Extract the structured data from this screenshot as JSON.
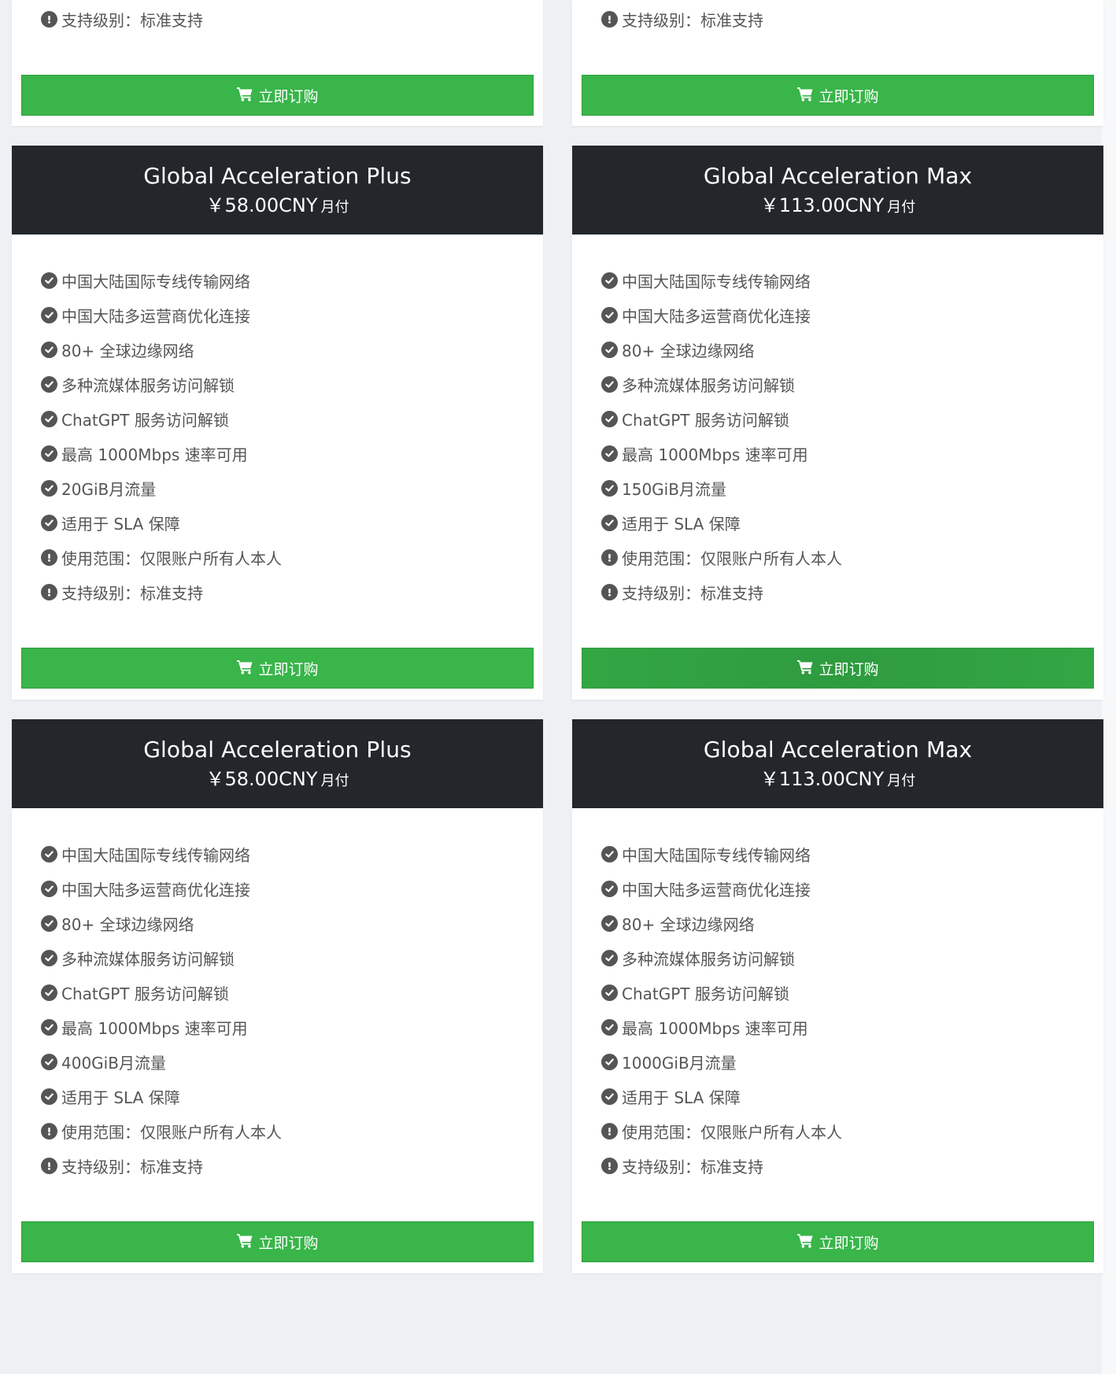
{
  "colors": {
    "header_bg": "#23272b",
    "button_green": "#39b54a",
    "page_bg": "#eef1f4",
    "text_gray": "#555555"
  },
  "icons": {
    "included": "check-circle-icon",
    "notice": "exclamation-circle-icon",
    "button": "shopping-cart-icon"
  },
  "top_partial_cards": [
    {
      "feature": {
        "icon": "exclamation",
        "text": "支持级别：标准支持"
      },
      "button_label": "立即订购"
    },
    {
      "feature": {
        "icon": "exclamation",
        "text": "支持级别：标准支持"
      },
      "button_label": "立即订购"
    }
  ],
  "plans": [
    {
      "name": "Global Acceleration Plus",
      "price": "￥58.00CNY",
      "cycle": "月付",
      "button_label": "立即订购",
      "features": [
        {
          "icon": "check",
          "text": "中国大陆国际专线传输网络"
        },
        {
          "icon": "check",
          "text": "中国大陆多运营商优化连接"
        },
        {
          "icon": "check",
          "text": "80+ 全球边缘网络"
        },
        {
          "icon": "check",
          "text": "多种流媒体服务访问解锁"
        },
        {
          "icon": "check",
          "text": "ChatGPT 服务访问解锁"
        },
        {
          "icon": "check",
          "text": "最高 1000Mbps 速率可用"
        },
        {
          "icon": "check",
          "text": "20GiB月流量"
        },
        {
          "icon": "check",
          "text": "适用于 SLA 保障"
        },
        {
          "icon": "exclamation",
          "text": "使用范围：仅限账户所有人本人"
        },
        {
          "icon": "exclamation",
          "text": "支持级别：标准支持"
        }
      ]
    },
    {
      "name": "Global Acceleration Max",
      "price": "￥113.00CNY",
      "cycle": "月付",
      "button_label": "立即订购",
      "features": [
        {
          "icon": "check",
          "text": "中国大陆国际专线传输网络"
        },
        {
          "icon": "check",
          "text": "中国大陆多运营商优化连接"
        },
        {
          "icon": "check",
          "text": "80+ 全球边缘网络"
        },
        {
          "icon": "check",
          "text": "多种流媒体服务访问解锁"
        },
        {
          "icon": "check",
          "text": "ChatGPT 服务访问解锁"
        },
        {
          "icon": "check",
          "text": "最高 1000Mbps 速率可用"
        },
        {
          "icon": "check",
          "text": "150GiB月流量"
        },
        {
          "icon": "check",
          "text": "适用于 SLA 保障"
        },
        {
          "icon": "exclamation",
          "text": "使用范围：仅限账户所有人本人"
        },
        {
          "icon": "exclamation",
          "text": "支持级别：标准支持"
        }
      ]
    },
    {
      "name": "Global Acceleration Plus",
      "price": "￥58.00CNY",
      "cycle": "月付",
      "button_label": "立即订购",
      "features": [
        {
          "icon": "check",
          "text": "中国大陆国际专线传输网络"
        },
        {
          "icon": "check",
          "text": "中国大陆多运营商优化连接"
        },
        {
          "icon": "check",
          "text": "80+ 全球边缘网络"
        },
        {
          "icon": "check",
          "text": "多种流媒体服务访问解锁"
        },
        {
          "icon": "check",
          "text": "ChatGPT 服务访问解锁"
        },
        {
          "icon": "check",
          "text": "最高 1000Mbps 速率可用"
        },
        {
          "icon": "check",
          "text": "400GiB月流量"
        },
        {
          "icon": "check",
          "text": "适用于 SLA 保障"
        },
        {
          "icon": "exclamation",
          "text": "使用范围：仅限账户所有人本人"
        },
        {
          "icon": "exclamation",
          "text": "支持级别：标准支持"
        }
      ]
    },
    {
      "name": "Global Acceleration Max",
      "price": "￥113.00CNY",
      "cycle": "月付",
      "button_label": "立即订购",
      "features": [
        {
          "icon": "check",
          "text": "中国大陆国际专线传输网络"
        },
        {
          "icon": "check",
          "text": "中国大陆多运营商优化连接"
        },
        {
          "icon": "check",
          "text": "80+ 全球边缘网络"
        },
        {
          "icon": "check",
          "text": "多种流媒体服务访问解锁"
        },
        {
          "icon": "check",
          "text": "ChatGPT 服务访问解锁"
        },
        {
          "icon": "check",
          "text": "最高 1000Mbps 速率可用"
        },
        {
          "icon": "check",
          "text": "1000GiB月流量"
        },
        {
          "icon": "check",
          "text": "适用于 SLA 保障"
        },
        {
          "icon": "exclamation",
          "text": "使用范围：仅限账户所有人本人"
        },
        {
          "icon": "exclamation",
          "text": "支持级别：标准支持"
        }
      ]
    }
  ]
}
